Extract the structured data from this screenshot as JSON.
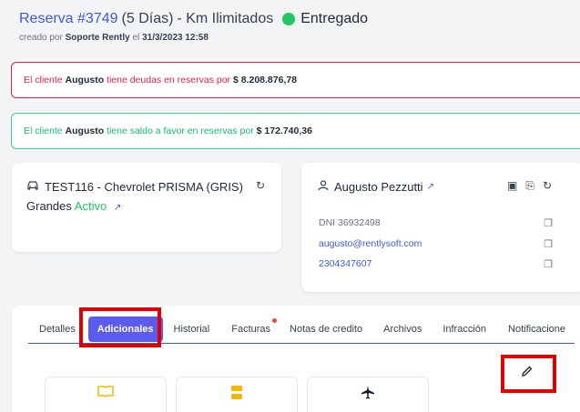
{
  "header": {
    "reserva_label": "Reserva #3749",
    "dias": "(5 Días)",
    "km": "- Km Ilimitados",
    "status": "Entregado",
    "status_color": "#22c55e",
    "created_prefix": "creado por",
    "created_by": "Soporte Rently",
    "created_mid": "el",
    "created_date": "31/3/2023 12:58"
  },
  "alerts": {
    "debt": {
      "prefix": "El cliente",
      "name": "Augusto",
      "mid": "tiene deudas en reservas por",
      "amount": "$ 8.208.876,78"
    },
    "credit": {
      "prefix": "El cliente",
      "name": "Augusto",
      "mid": "tiene saldo a favor en reservas por",
      "amount": "$ 172.740,36"
    }
  },
  "car": {
    "line1": "TEST116 - Chevrolet PRISMA (GRIS)",
    "group": "Grandes",
    "status": "Activo"
  },
  "customer": {
    "name": "Augusto Pezzutti",
    "dni": "DNI 36932498",
    "email": "augusto@rentlysoft.com",
    "phone": "2304347607"
  },
  "tabs": [
    {
      "label": "Detalles"
    },
    {
      "label": "Adicionales"
    },
    {
      "label": "Historial"
    },
    {
      "label": "Facturas"
    },
    {
      "label": "Notas de credito"
    },
    {
      "label": "Archivos"
    },
    {
      "label": "Infracción"
    },
    {
      "label": "Notificacione"
    }
  ],
  "additional_cards": [
    {
      "icon": "book-icon",
      "label": ""
    },
    {
      "icon": "ticket-icon",
      "label": ""
    },
    {
      "icon": "airplane-icon",
      "label": ""
    }
  ],
  "colors": {
    "accent": "#5b5bf0",
    "link": "#3b5bdb",
    "danger": "#e11d48",
    "success": "#10b981",
    "highlight": "#e00000"
  }
}
